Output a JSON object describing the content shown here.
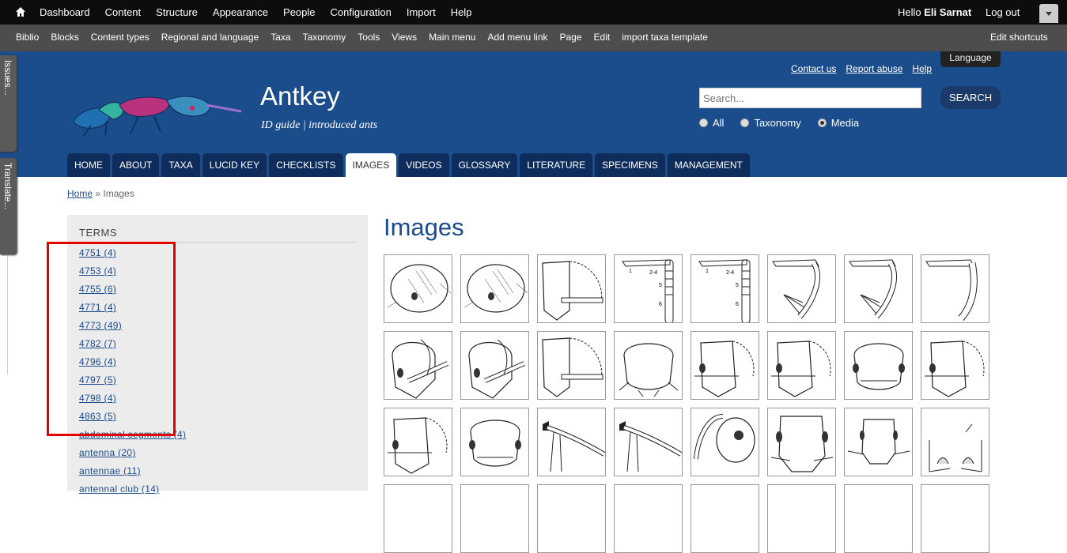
{
  "toolbar": {
    "menu": [
      "Dashboard",
      "Content",
      "Structure",
      "Appearance",
      "People",
      "Configuration",
      "Import",
      "Help"
    ],
    "hello": "Hello",
    "user": "Eli Sarnat",
    "logout": "Log out"
  },
  "shortcuts": {
    "items": [
      "Biblio",
      "Blocks",
      "Content types",
      "Regional and language",
      "Taxa",
      "Taxonomy",
      "Tools",
      "Views",
      "Main menu",
      "Add menu link",
      "Page",
      "Edit",
      "import taxa template"
    ],
    "edit": "Edit shortcuts"
  },
  "side_tabs": [
    "Issues...",
    "Translate..."
  ],
  "header": {
    "site_name": "Antkey",
    "slogan": "ID guide | introduced ants",
    "links": [
      "Contact us",
      "Report abuse",
      "Help"
    ],
    "language": "Language",
    "search_placeholder": "Search...",
    "search_button": "SEARCH",
    "scope": [
      {
        "label": "All",
        "selected": false
      },
      {
        "label": "Taxonomy",
        "selected": false
      },
      {
        "label": "Media",
        "selected": true
      }
    ]
  },
  "nav": [
    "HOME",
    "ABOUT",
    "TAXA",
    "LUCID KEY",
    "CHECKLISTS",
    "IMAGES",
    "VIDEOS",
    "GLOSSARY",
    "LITERATURE",
    "SPECIMENS",
    "MANAGEMENT"
  ],
  "nav_active": "IMAGES",
  "breadcrumb": {
    "home": "Home",
    "sep": " » ",
    "current": "Images"
  },
  "sidebar": {
    "heading": "TERMS",
    "terms": [
      "4751 (4)",
      "4753 (4)",
      "4755 (6)",
      "4771 (4)",
      "4773 (49)",
      "4782 (7)",
      "4796 (4)",
      "4797 (5)",
      "4798 (4)",
      "4863 (5)",
      "abdominal segments (4)",
      "antenna (20)",
      "antennae (11)",
      "antennal club (14)"
    ]
  },
  "main": {
    "title": "Images"
  },
  "thumbnails": [
    "head-oval-lateral",
    "head-oval-lateral",
    "head-scape-dashed",
    "antenna-segments-numbered",
    "antenna-segments-numbered",
    "antenna-club-arrows",
    "antenna-club-arrows",
    "antenna-segmented",
    "head-scape-front",
    "head-scape-front",
    "head-scape-dashed",
    "head-front",
    "head-front-dashed",
    "head-front-dashed",
    "head-front-eyes",
    "head-front-dashed",
    "head-front-dashed",
    "head-front-eyes",
    "scape-setae",
    "scape-setae",
    "head-lateral-eye",
    "head-front-long",
    "head-front-narrow",
    "head-front-arrow"
  ],
  "colors": {
    "header": "#1b4c8c",
    "nav": "#0f2d5c",
    "highlight": "#e50000"
  }
}
